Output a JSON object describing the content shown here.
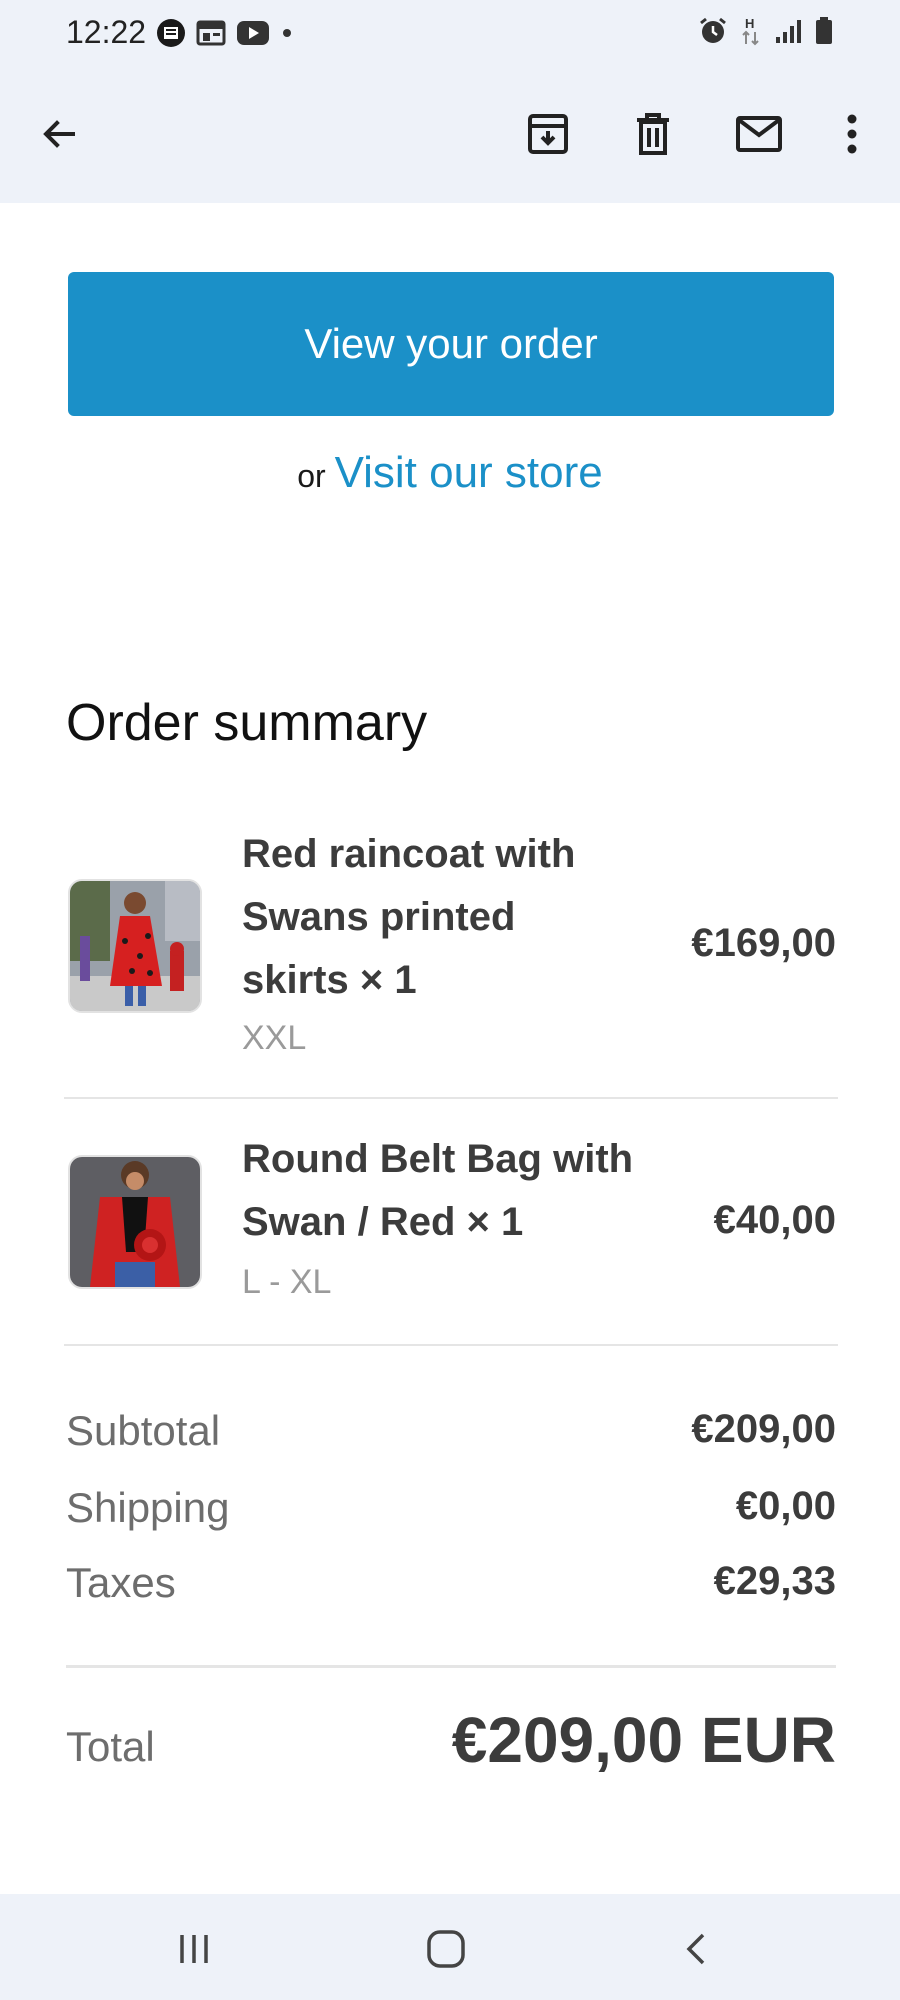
{
  "status_bar": {
    "time": "12:22",
    "left_icons": [
      "news-badge-icon",
      "calendar-widget-icon",
      "youtube-icon",
      "dot-icon"
    ],
    "right_icons": [
      "alarm-icon",
      "data-h-icon",
      "signal-icon",
      "battery-icon"
    ]
  },
  "appbar": {
    "icons": [
      "back-arrow-icon",
      "archive-icon",
      "delete-icon",
      "mail-icon",
      "more-vert-icon"
    ]
  },
  "cta": {
    "label": "View your order"
  },
  "visit": {
    "prefix": "or",
    "link": "Visit our store"
  },
  "order_summary": {
    "title": "Order summary",
    "items": [
      {
        "title_lines": [
          "Red raincoat with",
          "Swans printed",
          "skirts × 1"
        ],
        "variant": "XXL",
        "price": "€169,00"
      },
      {
        "title_lines": [
          "Round Belt Bag with",
          "Swan / Red × 1"
        ],
        "variant": "L - XL",
        "price": "€40,00"
      }
    ],
    "subtotal": {
      "label": "Subtotal",
      "value": "€209,00"
    },
    "shipping": {
      "label": "Shipping",
      "value": "€0,00"
    },
    "taxes": {
      "label": "Taxes",
      "value": "€29,33"
    },
    "total": {
      "label": "Total",
      "value": "€209,00 EUR"
    }
  },
  "nav_bar": {
    "icons": [
      "recent-apps-icon",
      "home-icon",
      "back-nav-icon"
    ]
  },
  "colors": {
    "accent": "#1b90c8",
    "bar_bg": "#eef2f9",
    "text_dark": "#3c3c3c",
    "text_muted": "#6d6d6d"
  }
}
